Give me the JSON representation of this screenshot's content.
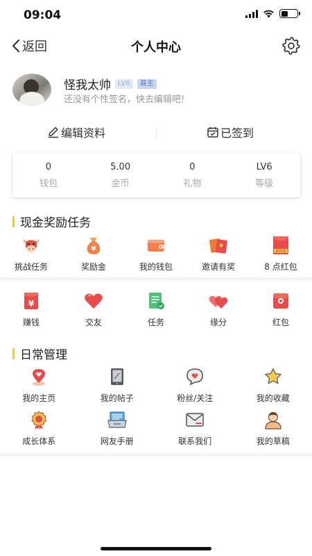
{
  "status_bar": {
    "time": "09:04",
    "battery_level": 0.45
  },
  "nav": {
    "back_label": "返回",
    "title": "个人中心"
  },
  "profile": {
    "username": "怪我太帅",
    "level_badge": "LV6",
    "role_badge": "县主",
    "signature": "还没有个性签名，快去编辑吧!"
  },
  "actions": {
    "edit_label": "编辑资料",
    "sign_label": "已签到"
  },
  "stats": [
    {
      "value": "0",
      "label": "钱包"
    },
    {
      "value": "5.00",
      "label": "金币"
    },
    {
      "value": "0",
      "label": "礼物"
    },
    {
      "value": "LV6",
      "label": "等级"
    }
  ],
  "cash_tasks": {
    "title": "现金奖励任务",
    "items": [
      {
        "label": "挑战任务",
        "icon": "cow-icon"
      },
      {
        "label": "奖励金",
        "icon": "money-bag-icon"
      },
      {
        "label": "我的钱包",
        "icon": "wallet-icon"
      },
      {
        "label": "邀请有奖",
        "icon": "red-envelopes-icon"
      },
      {
        "label": "8 点红包",
        "icon": "red-packet-icon",
        "icon_text": "拆红包"
      }
    ]
  },
  "features": {
    "items": [
      {
        "label": "赚钱",
        "icon": "yuan-icon"
      },
      {
        "label": "交友",
        "icon": "heart-icon"
      },
      {
        "label": "任务",
        "icon": "task-doc-icon"
      },
      {
        "label": "缘分",
        "icon": "double-heart-icon"
      },
      {
        "label": "红包",
        "icon": "red-packet-heart-icon"
      }
    ]
  },
  "daily": {
    "title": "日常管理",
    "row1": [
      {
        "label": "我的主页",
        "icon": "location-heart-icon"
      },
      {
        "label": "我的帖子",
        "icon": "tablet-icon"
      },
      {
        "label": "粉丝/关注",
        "icon": "chat-heart-icon"
      },
      {
        "label": "我的收藏",
        "icon": "star-icon"
      }
    ],
    "row2": [
      {
        "label": "成长体系",
        "icon": "medal-icon"
      },
      {
        "label": "网友手册",
        "icon": "manual-icon"
      },
      {
        "label": "联系我们",
        "icon": "mail-icon"
      },
      {
        "label": "我的草稿",
        "icon": "person-icon"
      }
    ]
  },
  "colors": {
    "accent": "#f3c74b",
    "red": "#e84b4b",
    "green": "#4ec07a"
  }
}
